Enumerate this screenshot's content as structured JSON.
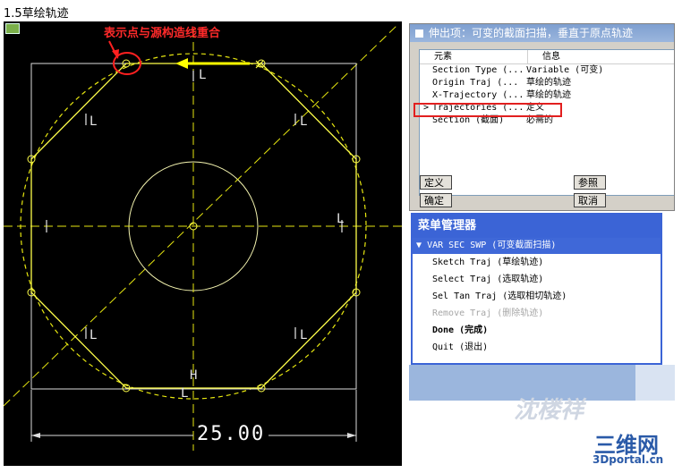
{
  "page": {
    "title": "1.5草绘轨迹"
  },
  "canvas": {
    "annotation": "表示点与源构造线重合",
    "dimension": "25.00",
    "marker_L": "L",
    "marker_H": "H"
  },
  "dialog": {
    "title": "伸出项：可变的截面扫描，垂直于原点轨迹",
    "columns": [
      "元素",
      "信息"
    ],
    "rows": [
      {
        "element": "Section Type (...",
        "info": "Variable (可变)"
      },
      {
        "element": "Origin Traj (...",
        "info": "草绘的轨迹"
      },
      {
        "element": "X-Trajectory (...",
        "info": "草绘的轨迹"
      },
      {
        "element": "Trajectories (...",
        "info": "定义",
        "marker": ">"
      },
      {
        "element": "Section (截面)",
        "info": "必需的"
      }
    ],
    "buttons": {
      "define": "定义",
      "refs": "参照",
      "ok": "确定",
      "cancel": "取消"
    }
  },
  "menu": {
    "title": "菜单管理器",
    "submenu": "VAR SEC SWP (可变截面扫描)",
    "items": [
      {
        "label": "Sketch Traj (草绘轨迹)"
      },
      {
        "label": "Select Traj (选取轨迹)"
      },
      {
        "label": "Sel Tan Traj (选取相切轨迹)"
      },
      {
        "label": "Remove Traj (删除轨迹)"
      },
      {
        "label": "Done (完成)"
      },
      {
        "label": "Quit (退出)"
      }
    ]
  },
  "watermark": {
    "text": "沈楼祥",
    "brand": "三维网",
    "url": "3Dportal.cn"
  },
  "colors": {
    "sketch": "#ffff33",
    "annotation": "#ff2a2a",
    "menu_header": "#3b64d6"
  }
}
